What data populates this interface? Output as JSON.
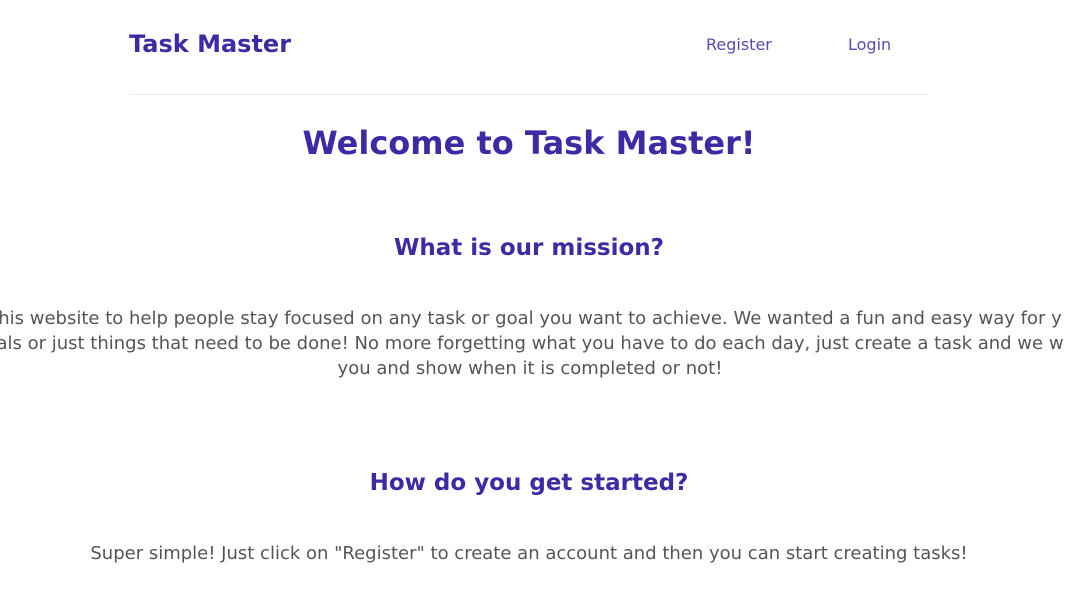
{
  "navbar": {
    "brand": "Task Master",
    "links": [
      "Register",
      "Login"
    ]
  },
  "main": {
    "title": "Welcome to Task Master!",
    "sections": [
      {
        "heading": "What is our mission?",
        "lines": [
          "his website to help people stay focused on any task or goal you want to achieve. We wanted a fun and easy way for y",
          "als or just things that need to be done! No more forgetting what you have to do each day, just create a task and we w",
          "you and show when it is completed or not!"
        ]
      },
      {
        "heading": "How do you get started?",
        "text": "Super simple! Just click on \"Register\" to create an account and then you can start creating tasks!"
      }
    ]
  },
  "colors": {
    "primary": "#3f2aa6",
    "link": "#5a4bb0",
    "body_text": "#555555"
  }
}
